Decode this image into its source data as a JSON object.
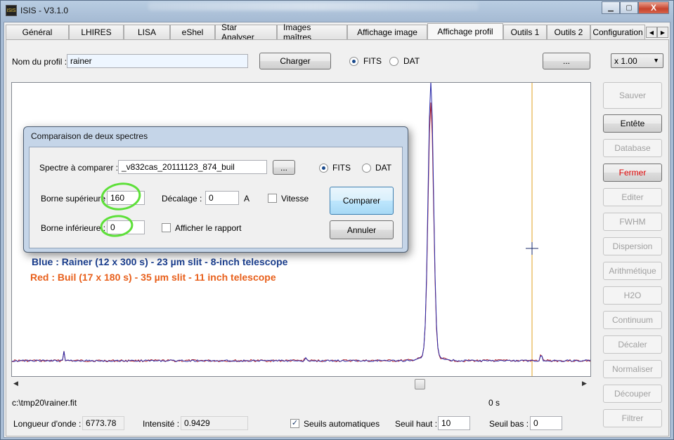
{
  "window": {
    "title": "ISIS - V3.1.0",
    "app_icon_text": "ISIS",
    "minimize": "▁",
    "maximize": "▢",
    "close": "X"
  },
  "tabs": [
    {
      "label": "Général"
    },
    {
      "label": "LHIRES"
    },
    {
      "label": "LISA"
    },
    {
      "label": "eShel"
    },
    {
      "label": "Star Analyser"
    },
    {
      "label": "Images maîtres"
    },
    {
      "label": "Affichage image"
    },
    {
      "label": "Affichage profil"
    },
    {
      "label": "Outils 1"
    },
    {
      "label": "Outils 2"
    },
    {
      "label": "Configuration"
    }
  ],
  "tab_scroll": {
    "left": "◀",
    "right": "▶"
  },
  "profile": {
    "name_label": "Nom du profil :",
    "name_value": "rainer",
    "load_button": "Charger",
    "fits_label": "FITS",
    "dat_label": "DAT",
    "browse_button": "...",
    "zoom_value": "x 1.00"
  },
  "side_buttons": [
    {
      "label": "Sauver",
      "state": "disabled"
    },
    {
      "label": "Entête",
      "state": "enabled"
    },
    {
      "label": "Database",
      "state": "disabled"
    },
    {
      "label": "Fermer",
      "state": "red"
    },
    {
      "label": "Editer",
      "state": "disabled"
    },
    {
      "label": "FWHM",
      "state": "disabled"
    },
    {
      "label": "Dispersion",
      "state": "disabled"
    },
    {
      "label": "Arithmétique",
      "state": "disabled"
    },
    {
      "label": "H2O",
      "state": "disabled"
    },
    {
      "label": "Continuum",
      "state": "disabled"
    },
    {
      "label": "Décaler",
      "state": "disabled"
    },
    {
      "label": "Normaliser",
      "state": "disabled"
    },
    {
      "label": "Découper",
      "state": "disabled"
    },
    {
      "label": "Filtrer",
      "state": "disabled"
    }
  ],
  "dialog": {
    "title": "Comparaison de deux spectres",
    "spectrum_label": "Spectre à comparer  :",
    "spectrum_value": "_v832cas_20111123_874_buil",
    "browse_button": "...",
    "fits_label": "FITS",
    "dat_label": "DAT",
    "upper_label": "Borne supérieure :",
    "upper_value": "160",
    "lower_label": "Borne inférieure :",
    "lower_value": "0",
    "offset_label": "Décalage :",
    "offset_value": "0",
    "offset_unit": "A",
    "speed_label": "Vitesse",
    "report_label": "Afficher le rapport",
    "compare_button": "Comparer",
    "cancel_button": "Annuler"
  },
  "annotations": {
    "blue_text": "Blue : Rainer (12 x 300 s) - 23 µm slit - 8-inch telescope",
    "red_text": "Red : Buil (17 x 180 s) - 35 µm slit - 11 inch telescope",
    "blue_color": "#1b3f8f",
    "red_color": "#e8601c",
    "highlight_color": "#5ee03a"
  },
  "plot": {
    "blue_series_color": "#2a2aa8",
    "red_series_color": "#b0202a",
    "cursor_line_color": "#e0a020"
  },
  "status": {
    "file_path": "c:\\tmp20\\rainer.fit",
    "time": "0 s",
    "wavelength_label": "Longueur d'onde :",
    "wavelength_value": "6773.78",
    "intensity_label": "Intensité :",
    "intensity_value": "0.9429",
    "auto_thresholds_label": "Seuils automatiques",
    "high_label": "Seuil haut :",
    "high_value": "10",
    "low_label": "Seuil bas :",
    "low_value": "0"
  }
}
